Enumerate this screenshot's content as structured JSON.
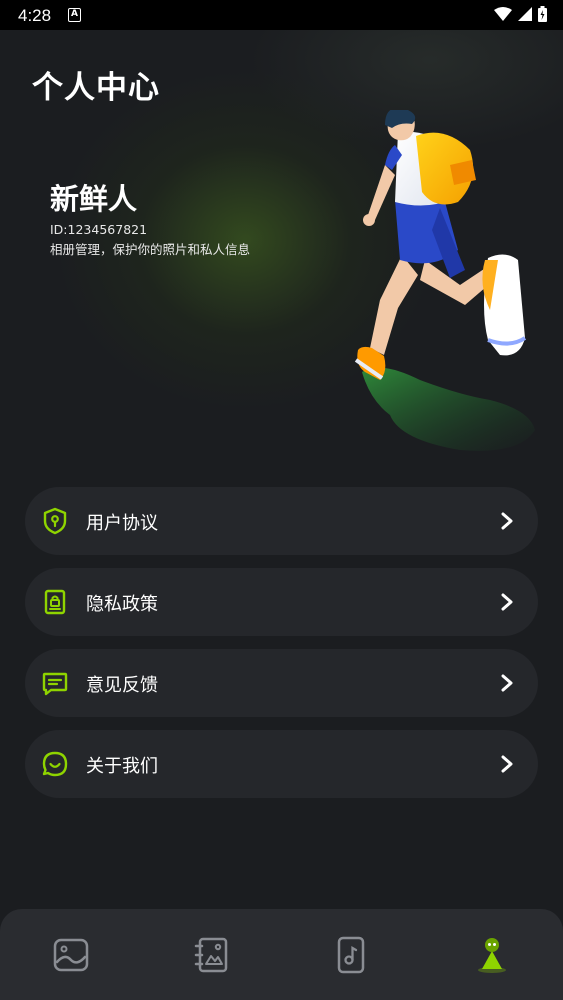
{
  "status_bar": {
    "time": "4:28",
    "notification_icon": "a-icon",
    "icons": [
      "wifi-icon",
      "signal-icon",
      "battery-icon"
    ]
  },
  "header": {
    "title": "个人中心"
  },
  "profile": {
    "name": "新鲜人",
    "id_text": "ID:1234567821",
    "description": "相册管理，保护你的照片和私人信息"
  },
  "menu": {
    "items": [
      {
        "label": "用户协议",
        "icon": "shield-icon"
      },
      {
        "label": "隐私政策",
        "icon": "privacy-document-icon"
      },
      {
        "label": "意见反馈",
        "icon": "feedback-icon"
      },
      {
        "label": "关于我们",
        "icon": "chat-smile-icon"
      }
    ]
  },
  "tabs": [
    {
      "icon": "photo-icon",
      "active": false
    },
    {
      "icon": "album-icon",
      "active": false
    },
    {
      "icon": "music-file-icon",
      "active": false
    },
    {
      "icon": "profile-icon",
      "active": true
    }
  ],
  "colors": {
    "accent": "#8fd400",
    "background": "#1b1d20",
    "card": "#25272b",
    "tabbar": "#2a2c30"
  }
}
